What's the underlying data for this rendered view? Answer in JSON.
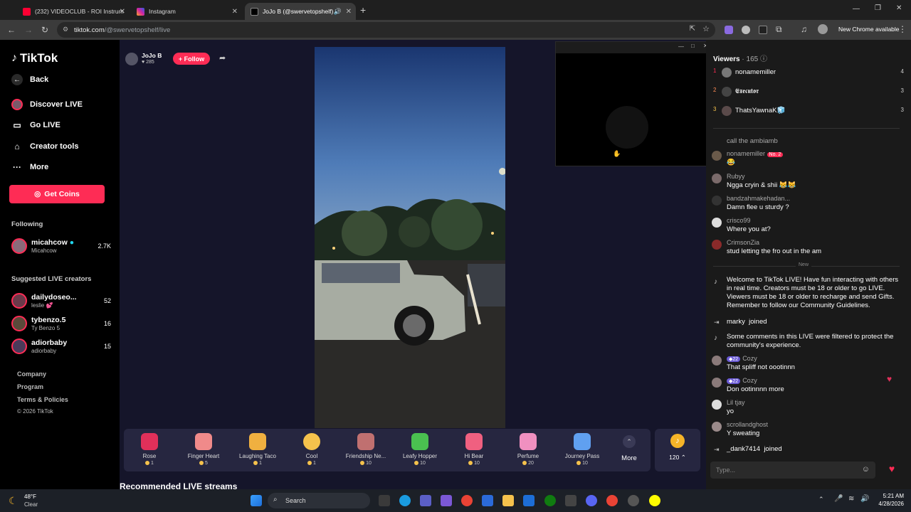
{
  "browser": {
    "tabs": [
      {
        "title": "(232) VIDEOCLUB - ROI Instrum",
        "icon": "youtube-icon",
        "color": "#ff0033"
      },
      {
        "title": "Instagram",
        "icon": "instagram-icon",
        "color": "#d6249f"
      },
      {
        "title": "JoJo B (@swervetopshelf) is",
        "icon": "tiktok-icon",
        "color": "#ffffff"
      }
    ],
    "url_domain": "tiktok.com",
    "url_path": "/@swervetopshelf/live",
    "new_chrome": "New Chrome available"
  },
  "sidebar": {
    "logo": "TikTok",
    "back": "Back",
    "nav": [
      "Discover LIVE",
      "Go LIVE",
      "Creator tools",
      "More"
    ],
    "get_coins": "Get Coins",
    "following_title": "Following",
    "following": [
      {
        "name": "micahcow",
        "sub": "Micahcow",
        "count": "2.7K"
      }
    ],
    "suggested_title": "Suggested LIVE creators",
    "suggested": [
      {
        "name": "dailydoseo...",
        "sub": "leslie 💕",
        "count": "52"
      },
      {
        "name": "tybenzo.5",
        "sub": "Ty Benzo 5",
        "count": "16"
      },
      {
        "name": "adiorbaby",
        "sub": "adiorbaby",
        "count": "15"
      }
    ],
    "footer": [
      "Company",
      "Program",
      "Terms & Policies"
    ],
    "copyright": "© 2026 TikTok"
  },
  "host": {
    "name": "JoJo B",
    "likes": "285",
    "follow": "+ Follow"
  },
  "gifts": [
    {
      "name": "Rose",
      "price": "1",
      "color": "#e0305a"
    },
    {
      "name": "Finger Heart",
      "price": "5",
      "color": "#f08a8a"
    },
    {
      "name": "Laughing Taco",
      "price": "1",
      "color": "#f0b040"
    },
    {
      "name": "Cool",
      "price": "1",
      "color": "#f5c24c"
    },
    {
      "name": "Friendship Ne...",
      "price": "10",
      "color": "#c07070"
    },
    {
      "name": "Leafy Hopper",
      "price": "10",
      "color": "#4ac050"
    },
    {
      "name": "Hi Bear",
      "price": "10",
      "color": "#f06080"
    },
    {
      "name": "Perfume",
      "price": "20",
      "color": "#f090c0"
    },
    {
      "name": "Journey Pass",
      "price": "10",
      "color": "#60a0f0"
    }
  ],
  "gift_more": "More",
  "coin_balance": "120",
  "recommended": "Recommended LIVE streams",
  "viewers": {
    "title": "Viewers",
    "count": "165",
    "top": [
      {
        "rank": "1",
        "name": "nonamemiller",
        "score": "4"
      },
      {
        "rank": "2",
        "name": "𝕰𝖝𝖊𝖈𝖚𝖙𝖔𝖗",
        "score": "3"
      },
      {
        "rank": "3",
        "name": "ThatsYawnaK🧊",
        "score": "3"
      }
    ]
  },
  "chat": {
    "first_partial": "call the ambiamb",
    "messages_old": [
      {
        "user": "nonamemiller",
        "badge": "No. 2",
        "text": "😂"
      },
      {
        "user": "Rubyy",
        "text": "Ngga cryin & shii 😹😹"
      },
      {
        "user": "bandzahmakehadan...",
        "text": "Damn flee u sturdy ?"
      },
      {
        "user": "crisco99",
        "text": "Where you at?"
      },
      {
        "user": "CrimsonZia",
        "text": "stud letting the fro out in the am"
      }
    ],
    "new_label": "New",
    "welcome": "Welcome to TikTok LIVE! Have fun interacting with others in real time. Creators must be 18 or older to go LIVE. Viewers must be 18 or older to recharge and send Gifts. Remember to follow our Community Guidelines.",
    "joined_1_user": "marky",
    "joined_word": "joined",
    "filtered": "Some comments in this LIVE were filtered to protect the community's experience.",
    "messages_new": [
      {
        "badge": "22",
        "user": "Cozy",
        "text": "That spliff not oootinnn"
      },
      {
        "badge": "22",
        "user": "Cozy",
        "text": "Don ootinnnn more"
      },
      {
        "user": "Lil tjay",
        "text": "yo"
      },
      {
        "user": "scrollandghost",
        "text": "Y sweating"
      }
    ],
    "joined_2_user": "_dank7414",
    "input_placeholder": "Type..."
  },
  "taskbar": {
    "weather_temp": "48°F",
    "weather_desc": "Clear",
    "search": "Search",
    "time": "5:21 AM",
    "date": "4/28/2026"
  }
}
